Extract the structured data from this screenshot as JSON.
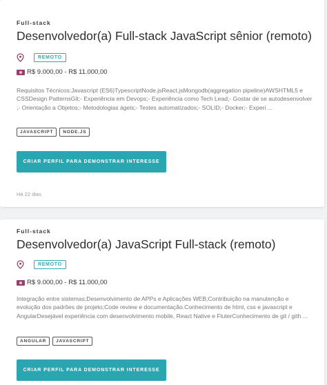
{
  "jobs": [
    {
      "category": "Full-stack",
      "title": "Desenvolvedor(a) Full-stack JavaScript sênior (remoto)",
      "badge": "REMOTO",
      "salary": "R$ 9.000,00 - R$ 11.000,00",
      "description": "Requisitos Técnicos:Javascript (ES6)TypescriptNode.jsReact.jsMongodb(aggregation pipeline)AWSHTML5 e CSSDesign PatternsGit;- Experiência em Devops;- Experiência como Tech Lead;- Gostar de se autodesenvolver ;- Orientação a Objetos;- Metodologias ágeis;- Testes automatizados;- SOLID;- Docker;- Experi ...",
      "tags": [
        "JAVASCRIPT",
        "NODE.JS"
      ],
      "cta": "CRIAR PERFIL PARA DEMONSTRAR INTERESSE",
      "posted": "Há 22 dias"
    },
    {
      "category": "Full-stack",
      "title": "Desenvolvedor(a) JavaScript Full-stack (remoto)",
      "badge": "REMOTO",
      "salary": "R$ 9.000,00 - R$ 11.000,00",
      "description": "Integração entre sistemas;Desenvolvimento de APPs e Aplicações WEB;Contribuição na manutenção e evolução dos padrões de projeto;Code review e documentação.Conhecimento de html, css e javascript e AngularDesejável experiência com desenvolvimento mobile, React Native e FluterConhecimento de git / gith ...",
      "tags": [
        "ANGULAR",
        "JAVASCRIPT"
      ],
      "cta": "CRIAR PERFIL PARA DEMONSTRAR INTERESSE"
    }
  ],
  "icons": {
    "location": "map-pin-icon",
    "salary": "money-icon"
  },
  "colors": {
    "accent": "#2aa6b0",
    "money_icon": "#9b3e6b",
    "background": "#f1f2f4"
  }
}
